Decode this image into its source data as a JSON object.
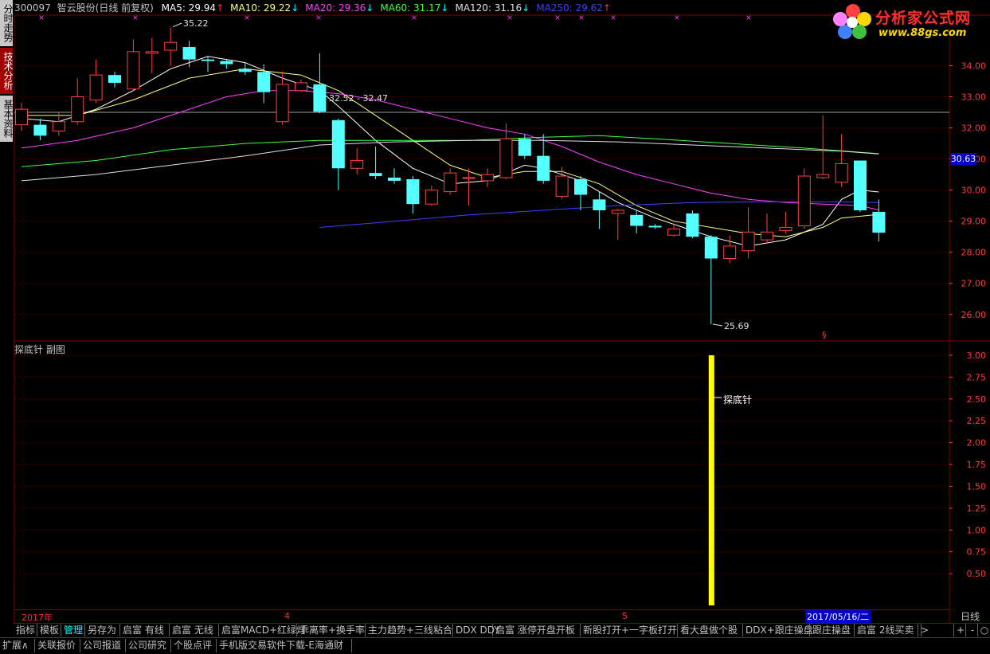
{
  "header": {
    "code": "300097",
    "name": "智云股份(日线 前复权)",
    "ma": [
      {
        "label": "MA5: 29.94",
        "arrow": "↑",
        "color": "#ffffff",
        "arrow_color": "#ff3030"
      },
      {
        "label": "MA10: 29.22",
        "arrow": "↓",
        "color": "#ffff80",
        "arrow_color": "#00ffff"
      },
      {
        "label": "MA20: 29.36",
        "arrow": "↓",
        "color": "#ff40ff",
        "arrow_color": "#00ffff"
      },
      {
        "label": "MA60: 31.17",
        "arrow": "↓",
        "color": "#40ff40",
        "arrow_color": "#00ffff"
      },
      {
        "label": "MA120: 31.16",
        "arrow": "↓",
        "color": "#e0e0e0",
        "arrow_color": "#00ffff"
      },
      {
        "label": "MA250: 29.62",
        "arrow": "↑",
        "color": "#4040ff",
        "arrow_color": "#ff3030"
      }
    ]
  },
  "logo": {
    "title": "分析家公式网",
    "url": "www.88gs.com"
  },
  "left_tabs": [
    {
      "label": "分时走势",
      "style": "gray"
    },
    {
      "label": "技术分析",
      "style": "red"
    },
    {
      "label": "基本资料",
      "style": "gray"
    }
  ],
  "main_panel": {
    "price_tag": "30.63",
    "annotations": {
      "high": "35.22",
      "range": "32.52 - 32.47",
      "low": "25.69",
      "mark": "§"
    }
  },
  "sub_panel": {
    "title": "探底针 副图",
    "signal_label": "探底针"
  },
  "axis_bottom": {
    "year": "2017年",
    "m4": "4",
    "m5": "5",
    "cursor_date": "2017/05/16/二",
    "period": "日线"
  },
  "chart_data": [
    {
      "type": "candlestick",
      "ylim": [
        25.2,
        35.6
      ],
      "y_ticks": [
        "34.00",
        "33.00",
        "32.00",
        "31.00",
        "30.00",
        "29.00",
        "28.00",
        "27.00",
        "26.00"
      ],
      "candles": [
        {
          "o": 32.1,
          "c": 32.6,
          "h": 32.8,
          "l": 31.9
        },
        {
          "o": 32.1,
          "c": 31.75,
          "h": 32.3,
          "l": 31.6
        },
        {
          "o": 31.9,
          "c": 32.2,
          "h": 32.5,
          "l": 31.75
        },
        {
          "o": 32.2,
          "c": 33.0,
          "h": 33.6,
          "l": 32.1
        },
        {
          "o": 32.9,
          "c": 33.7,
          "h": 34.2,
          "l": 32.8
        },
        {
          "o": 33.7,
          "c": 33.45,
          "h": 33.8,
          "l": 33.3
        },
        {
          "o": 33.25,
          "c": 34.45,
          "h": 34.85,
          "l": 33.2
        },
        {
          "o": 34.4,
          "c": 34.45,
          "h": 34.9,
          "l": 33.75
        },
        {
          "o": 34.5,
          "c": 34.75,
          "h": 35.22,
          "l": 34.0
        },
        {
          "o": 34.6,
          "c": 34.2,
          "h": 34.8,
          "l": 33.95
        },
        {
          "o": 34.2,
          "c": 34.15,
          "h": 34.3,
          "l": 33.8
        },
        {
          "o": 34.15,
          "c": 34.05,
          "h": 34.2,
          "l": 33.9
        },
        {
          "o": 33.9,
          "c": 33.8,
          "h": 34.1,
          "l": 33.7
        },
        {
          "o": 33.8,
          "c": 33.15,
          "h": 34.05,
          "l": 32.8
        },
        {
          "o": 32.2,
          "c": 33.4,
          "h": 33.8,
          "l": 32.1
        },
        {
          "o": 33.2,
          "c": 33.45,
          "h": 33.55,
          "l": 33.15
        },
        {
          "o": 33.4,
          "c": 32.52,
          "h": 34.4,
          "l": 32.47
        },
        {
          "o": 32.25,
          "c": 30.7,
          "h": 32.3,
          "l": 30.0
        },
        {
          "o": 30.7,
          "c": 30.95,
          "h": 31.35,
          "l": 30.5
        },
        {
          "o": 30.55,
          "c": 30.45,
          "h": 31.4,
          "l": 30.35
        },
        {
          "o": 30.4,
          "c": 30.3,
          "h": 30.7,
          "l": 30.2
        },
        {
          "o": 30.35,
          "c": 29.55,
          "h": 30.45,
          "l": 29.25
        },
        {
          "o": 29.55,
          "c": 30.0,
          "h": 30.15,
          "l": 29.5
        },
        {
          "o": 29.95,
          "c": 30.55,
          "h": 30.7,
          "l": 29.85
        },
        {
          "o": 30.4,
          "c": 30.4,
          "h": 30.7,
          "l": 29.5
        },
        {
          "o": 30.3,
          "c": 30.5,
          "h": 30.7,
          "l": 30.1
        },
        {
          "o": 30.4,
          "c": 31.65,
          "h": 32.15,
          "l": 30.35
        },
        {
          "o": 31.65,
          "c": 31.1,
          "h": 31.8,
          "l": 31.0
        },
        {
          "o": 31.1,
          "c": 30.3,
          "h": 31.8,
          "l": 30.2
        },
        {
          "o": 29.8,
          "c": 30.45,
          "h": 30.75,
          "l": 29.7
        },
        {
          "o": 30.35,
          "c": 29.85,
          "h": 30.45,
          "l": 29.35
        },
        {
          "o": 29.7,
          "c": 29.35,
          "h": 29.95,
          "l": 28.75
        },
        {
          "o": 29.25,
          "c": 29.35,
          "h": 29.4,
          "l": 28.4
        },
        {
          "o": 29.2,
          "c": 28.85,
          "h": 29.35,
          "l": 28.6
        },
        {
          "o": 28.85,
          "c": 28.8,
          "h": 28.9,
          "l": 28.75
        },
        {
          "o": 28.55,
          "c": 28.75,
          "h": 28.9,
          "l": 28.5
        },
        {
          "o": 29.25,
          "c": 28.5,
          "h": 29.35,
          "l": 28.45
        },
        {
          "o": 28.5,
          "c": 27.8,
          "h": 28.55,
          "l": 25.69
        },
        {
          "o": 27.8,
          "c": 28.2,
          "h": 28.55,
          "l": 27.65
        },
        {
          "o": 28.05,
          "c": 28.65,
          "h": 29.45,
          "l": 27.8
        },
        {
          "o": 28.4,
          "c": 28.65,
          "h": 29.25,
          "l": 28.3
        },
        {
          "o": 28.7,
          "c": 28.8,
          "h": 29.3,
          "l": 28.6
        },
        {
          "o": 28.85,
          "c": 30.45,
          "h": 30.7,
          "l": 28.75
        },
        {
          "o": 30.4,
          "c": 30.5,
          "h": 32.4,
          "l": 30.35
        },
        {
          "o": 30.25,
          "c": 30.85,
          "h": 31.8,
          "l": 30.1
        },
        {
          "o": 30.95,
          "c": 29.35,
          "h": 30.95,
          "l": 29.3
        },
        {
          "o": 29.3,
          "c": 28.63,
          "h": 29.7,
          "l": 28.35
        }
      ],
      "ma_lines": [
        {
          "name": "MA5",
          "color": "#ffffff",
          "points": [
            [
              0,
              32.3
            ],
            [
              2,
              32.2
            ],
            [
              4,
              32.6
            ],
            [
              6,
              33.2
            ],
            [
              8,
              33.9
            ],
            [
              10,
              34.3
            ],
            [
              12,
              34.1
            ],
            [
              14,
              33.6
            ],
            [
              16,
              33.2
            ],
            [
              17,
              32.7
            ],
            [
              19,
              31.6
            ],
            [
              21,
              30.7
            ],
            [
              23,
              30.2
            ],
            [
              25,
              30.3
            ],
            [
              27,
              30.8
            ],
            [
              28,
              30.7
            ],
            [
              30,
              30.3
            ],
            [
              32,
              29.6
            ],
            [
              34,
              29.1
            ],
            [
              36,
              28.7
            ],
            [
              37,
              28.5
            ],
            [
              39,
              28.2
            ],
            [
              41,
              28.4
            ],
            [
              43,
              28.9
            ],
            [
              44,
              29.7
            ],
            [
              45,
              30.0
            ],
            [
              46,
              29.94
            ]
          ]
        },
        {
          "name": "MA10",
          "color": "#ffff80",
          "points": [
            [
              0,
              32.4
            ],
            [
              3,
              32.4
            ],
            [
              6,
              32.9
            ],
            [
              9,
              33.6
            ],
            [
              12,
              33.9
            ],
            [
              15,
              33.7
            ],
            [
              17,
              33.2
            ],
            [
              19,
              32.4
            ],
            [
              21,
              31.6
            ],
            [
              23,
              30.8
            ],
            [
              25,
              30.4
            ],
            [
              27,
              30.6
            ],
            [
              29,
              30.6
            ],
            [
              31,
              30.2
            ],
            [
              33,
              29.5
            ],
            [
              35,
              29.0
            ],
            [
              37,
              28.8
            ],
            [
              39,
              28.6
            ],
            [
              41,
              28.5
            ],
            [
              43,
              28.8
            ],
            [
              44,
              29.1
            ],
            [
              46,
              29.22
            ]
          ]
        },
        {
          "name": "MA20",
          "color": "#ff40ff",
          "points": [
            [
              0,
              31.35
            ],
            [
              3,
              31.6
            ],
            [
              6,
              32.0
            ],
            [
              9,
              32.6
            ],
            [
              11,
              33.0
            ],
            [
              13,
              33.2
            ],
            [
              15,
              33.2
            ],
            [
              17,
              33.1
            ],
            [
              19,
              32.9
            ],
            [
              21,
              32.6
            ],
            [
              23,
              32.3
            ],
            [
              25,
              32.0
            ],
            [
              27,
              31.8
            ],
            [
              29,
              31.4
            ],
            [
              31,
              30.9
            ],
            [
              33,
              30.5
            ],
            [
              35,
              30.2
            ],
            [
              37,
              29.9
            ],
            [
              39,
              29.7
            ],
            [
              41,
              29.6
            ],
            [
              43,
              29.55
            ],
            [
              45,
              29.5
            ],
            [
              46,
              29.36
            ]
          ]
        },
        {
          "name": "MA60",
          "color": "#40ff40",
          "points": [
            [
              0,
              30.75
            ],
            [
              4,
              30.95
            ],
            [
              8,
              31.3
            ],
            [
              12,
              31.5
            ],
            [
              16,
              31.6
            ],
            [
              20,
              31.6
            ],
            [
              24,
              31.6
            ],
            [
              28,
              31.7
            ],
            [
              31,
              31.75
            ],
            [
              34,
              31.65
            ],
            [
              38,
              31.5
            ],
            [
              42,
              31.35
            ],
            [
              46,
              31.17
            ]
          ]
        },
        {
          "name": "MA120",
          "color": "#e0e0e0",
          "points": [
            [
              0,
              30.3
            ],
            [
              4,
              30.5
            ],
            [
              8,
              30.8
            ],
            [
              12,
              31.1
            ],
            [
              16,
              31.45
            ],
            [
              20,
              31.55
            ],
            [
              24,
              31.6
            ],
            [
              28,
              31.6
            ],
            [
              32,
              31.55
            ],
            [
              36,
              31.45
            ],
            [
              40,
              31.35
            ],
            [
              44,
              31.25
            ],
            [
              46,
              31.16
            ]
          ]
        },
        {
          "name": "MA250",
          "color": "#4040ff",
          "points": [
            [
              16,
              28.8
            ],
            [
              20,
              29.0
            ],
            [
              24,
              29.2
            ],
            [
              28,
              29.35
            ],
            [
              32,
              29.5
            ],
            [
              36,
              29.6
            ],
            [
              40,
              29.62
            ],
            [
              44,
              29.62
            ],
            [
              46,
              29.6
            ]
          ]
        }
      ],
      "ref_line": 32.5
    },
    {
      "type": "bar",
      "name": "探底针",
      "ylim": [
        0.1,
        3.0
      ],
      "y_ticks": [
        "3.00",
        "2.75",
        "2.50",
        "2.25",
        "2.00",
        "1.75",
        "1.50",
        "1.25",
        "1.00",
        "0.75",
        "0.50"
      ],
      "signal_index": 37,
      "value": 3.0
    }
  ],
  "tabs": [
    "指标",
    "模板",
    "管理",
    "另存为",
    "启富 有线",
    "启富 无线",
    "启富MACD+红绿灯",
    "乖离率+换手率",
    "主力趋势+三线粘合",
    "DDX DDY",
    "启富 涨停开盘开板",
    "新股打开+一字板打开",
    "看大盘做个股",
    "DDX+跟庄操盘",
    "跟庄操盘",
    "启富 2线买卖"
  ],
  "tab_nav": [
    ">",
    "+",
    "-",
    "○"
  ],
  "ext_tabs": [
    "扩展∧",
    "关联报价",
    "公司报道",
    "公司研究",
    "个股点评",
    "手机版交易软件下载-E海通财"
  ]
}
